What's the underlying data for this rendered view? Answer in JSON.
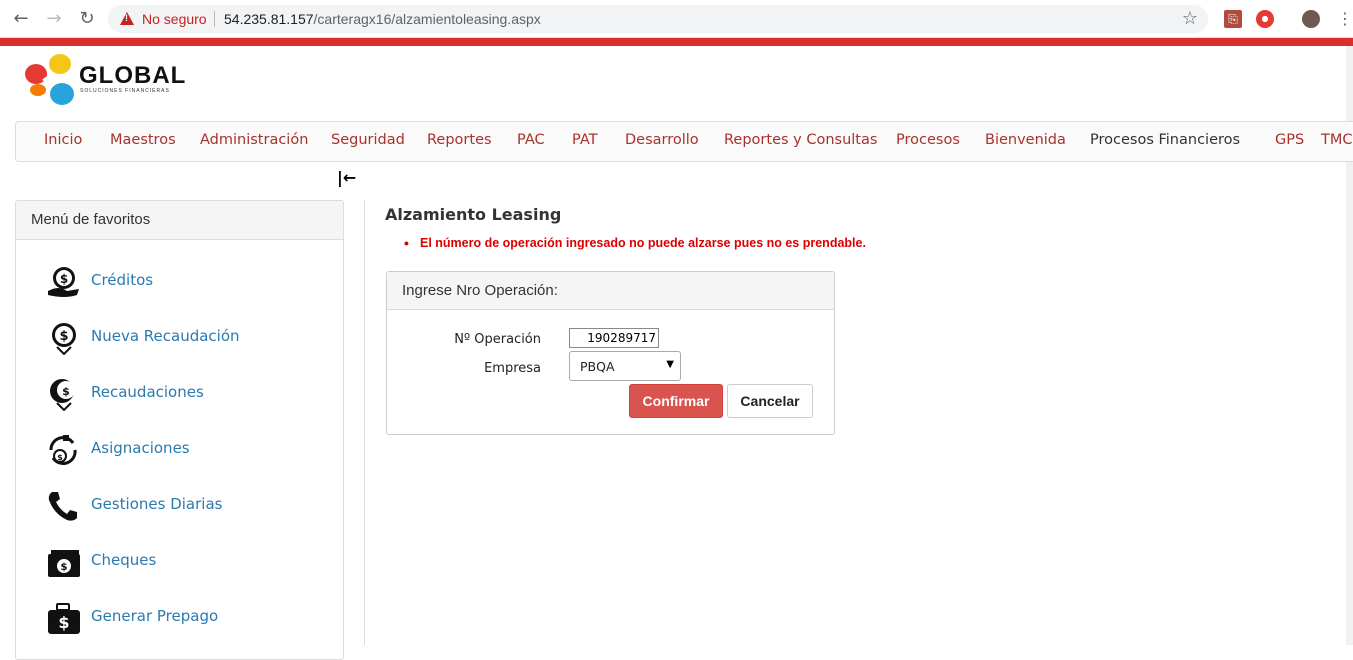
{
  "browser": {
    "security_label": "No seguro",
    "url_host": "54.235.81.157",
    "url_path": "/carteragx16/alzamientoleasing.aspx"
  },
  "logo": {
    "name": "GLOBAL",
    "tagline": "SOLUCIONES FINANCIERAS"
  },
  "topmenu": {
    "items": [
      "Inicio",
      "Maestros",
      "Administración",
      "Seguridad",
      "Reportes",
      "PAC",
      "PAT",
      "Desarrollo",
      "Reportes y Consultas",
      "Procesos",
      "Bienvenida",
      "Procesos Financieros",
      "GPS",
      "TMC"
    ]
  },
  "sidebar": {
    "title": "Menú de favoritos",
    "items": [
      {
        "label": "Créditos",
        "icon": "money-hand-icon"
      },
      {
        "label": "Nueva Recaudación",
        "icon": "coin-down-icon"
      },
      {
        "label": "Recaudaciones",
        "icon": "coin-stack-down-icon"
      },
      {
        "label": "Asignaciones",
        "icon": "money-cycle-icon"
      },
      {
        "label": "Gestiones Diarias",
        "icon": "phone-icon"
      },
      {
        "label": "Cheques",
        "icon": "cash-stack-icon"
      },
      {
        "label": "Generar Prepago",
        "icon": "briefcase-dollar-icon"
      }
    ]
  },
  "main": {
    "title": "Alzamiento Leasing",
    "error": "El número de operación ingresado no puede alzarse pues no es prendable.",
    "panel_title": "Ingrese Nro Operación:",
    "operation_label": "Nº Operación",
    "operation_value": "190289717",
    "company_label": "Empresa",
    "company_value": "PBQA",
    "confirm_label": "Confirmar",
    "cancel_label": "Cancelar"
  },
  "colors": {
    "accent_red": "#d9302f",
    "menu_text": "#a8322c",
    "link_blue": "#2a7ab0",
    "error_red": "#dd0000"
  }
}
